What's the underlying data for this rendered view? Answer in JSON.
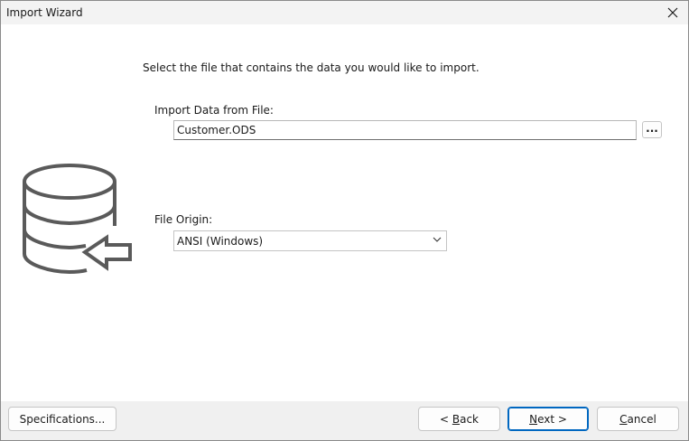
{
  "window": {
    "title": "Import Wizard",
    "close_icon": "close-icon"
  },
  "main": {
    "instruction": "Select the file that contains the data you would like to import.",
    "file_label": "Import Data from File:",
    "file_value": "Customer.ODS",
    "browse_label": "...",
    "origin_label": "File Origin:",
    "origin_selected": "ANSI (Windows)",
    "illustration_icon": "database-import-icon"
  },
  "footer": {
    "specifications_label": "Specifications...",
    "back_prefix": "< ",
    "back_mnemonic": "B",
    "back_rest": "ack",
    "next_mnemonic": "N",
    "next_rest": "ext >",
    "cancel_mnemonic": "C",
    "cancel_rest": "ancel"
  },
  "colors": {
    "accent": "#0067c0",
    "icon_gray": "#5a5a5a",
    "footer_bg": "#f0f0f0"
  }
}
